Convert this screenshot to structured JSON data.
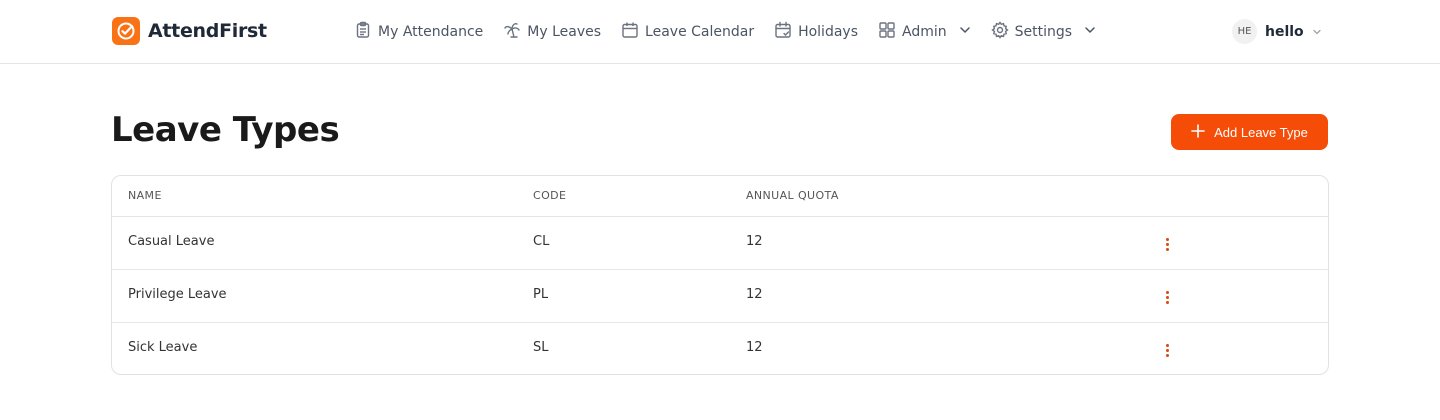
{
  "brand": {
    "name": "AttendFirst",
    "accent_color": "#f97316"
  },
  "nav": [
    {
      "label": "My Attendance",
      "icon": "clipboard-icon"
    },
    {
      "label": "My Leaves",
      "icon": "palm-tree-icon"
    },
    {
      "label": "Leave Calendar",
      "icon": "calendar-icon"
    },
    {
      "label": "Holidays",
      "icon": "calendar-check-icon"
    },
    {
      "label": "Admin",
      "icon": "grid-icon",
      "dropdown": true
    },
    {
      "label": "Settings",
      "icon": "gear-icon",
      "dropdown": true
    }
  ],
  "user": {
    "initials": "HE",
    "name": "hello"
  },
  "page": {
    "title": "Leave Types",
    "add_button_label": "Add Leave Type",
    "button_color": "#f54c08"
  },
  "table": {
    "headers": [
      "NAME",
      "CODE",
      "ANNUAL QUOTA"
    ],
    "rows": [
      {
        "name": "Casual Leave",
        "code": "CL",
        "quota": "12"
      },
      {
        "name": "Privilege Leave",
        "code": "PL",
        "quota": "12"
      },
      {
        "name": "Sick Leave",
        "code": "SL",
        "quota": "12"
      }
    ]
  }
}
